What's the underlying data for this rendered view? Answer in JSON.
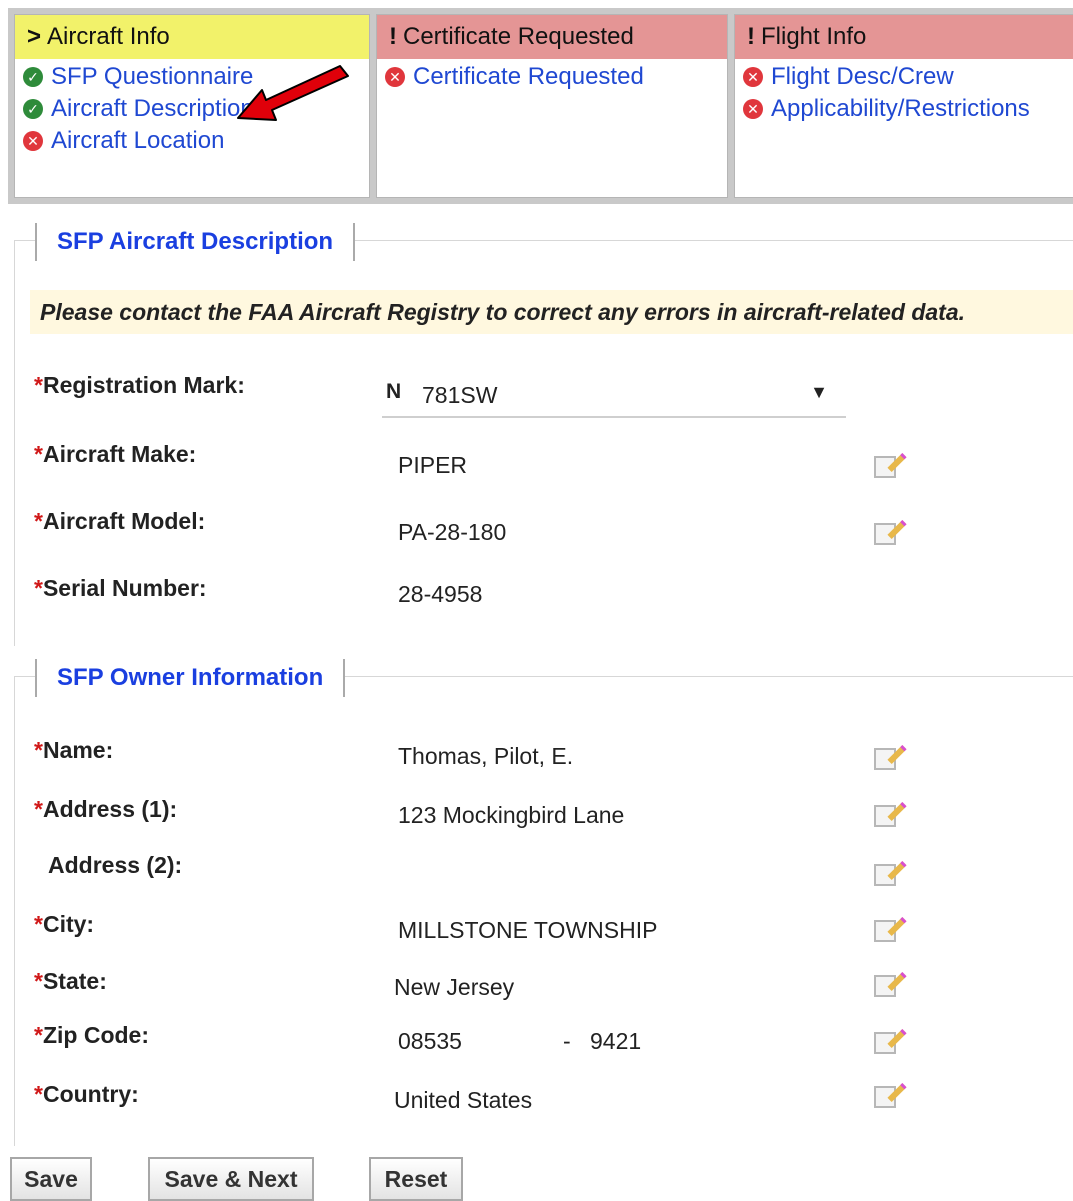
{
  "steps": {
    "aircraft_info": {
      "mark": ">",
      "title": "Aircraft Info",
      "items": [
        {
          "label": "SFP Questionnaire",
          "status": "complete",
          "icon": "check-circle-icon"
        },
        {
          "label": "Aircraft Description",
          "status": "complete",
          "icon": "check-circle-icon"
        },
        {
          "label": "Aircraft Location",
          "status": "error",
          "icon": "error-circle-icon"
        }
      ]
    },
    "certificate_requested": {
      "mark": "!",
      "title": "Certificate Requested",
      "items": [
        {
          "label": "Certificate Requested",
          "status": "error",
          "icon": "error-circle-icon"
        }
      ]
    },
    "flight_info": {
      "mark": "!",
      "title": "Flight Info",
      "items": [
        {
          "label": "Flight Desc/Crew",
          "status": "error",
          "icon": "error-circle-icon"
        },
        {
          "label": "Applicability/Restrictions",
          "status": "error",
          "icon": "error-circle-icon"
        }
      ]
    }
  },
  "aircraft_description": {
    "legend": "SFP Aircraft Description",
    "notice": "Please contact the FAA Aircraft Registry to correct any errors in aircraft-related data.",
    "fields": {
      "registration_mark": {
        "label": "Registration Mark:",
        "prefix": "N",
        "value": "781SW"
      },
      "make": {
        "label": "Aircraft Make:",
        "value": "PIPER"
      },
      "model": {
        "label": "Aircraft Model:",
        "value": "PA-28-180"
      },
      "serial": {
        "label": "Serial Number:",
        "value": "28-4958"
      }
    }
  },
  "owner_information": {
    "legend": "SFP Owner Information",
    "fields": {
      "name": {
        "label": "Name:",
        "value": "Thomas, Pilot, E."
      },
      "address1": {
        "label": "Address (1):",
        "value": "123 Mockingbird Lane"
      },
      "address2": {
        "label": "Address (2):",
        "value": ""
      },
      "city": {
        "label": "City:",
        "value": "MILLSTONE TOWNSHIP"
      },
      "state": {
        "label": "State:",
        "value": "New Jersey"
      },
      "zip": {
        "label": "Zip Code:",
        "value": "08535",
        "separator": "-",
        "ext": "9421"
      },
      "country": {
        "label": "Country:",
        "value": "United States"
      }
    }
  },
  "required_marker": "*",
  "dropdown_glyph": "▼",
  "buttons": {
    "save": "Save",
    "save_next": "Save & Next",
    "reset": "Reset"
  },
  "colors": {
    "step_active": "#f2f26a",
    "step_error": "#e49595",
    "link": "#1f48d2",
    "legend": "#1a3fe0",
    "required": "#d01818",
    "annotation_arrow": "#e0000a"
  }
}
